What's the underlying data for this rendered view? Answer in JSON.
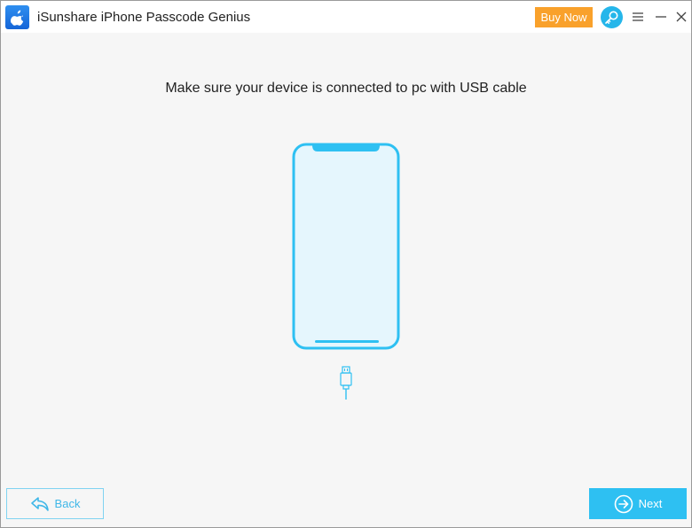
{
  "titlebar": {
    "app_title": "iSunshare iPhone Passcode Genius",
    "buy_now_label": "Buy Now"
  },
  "main": {
    "instruction": "Make sure your device is connected to pc with USB cable"
  },
  "footer": {
    "back_label": "Back",
    "next_label": "Next"
  },
  "colors": {
    "accent": "#2ec0f2",
    "buy_now": "#f9a12b",
    "app_icon": "#1e78e4"
  }
}
